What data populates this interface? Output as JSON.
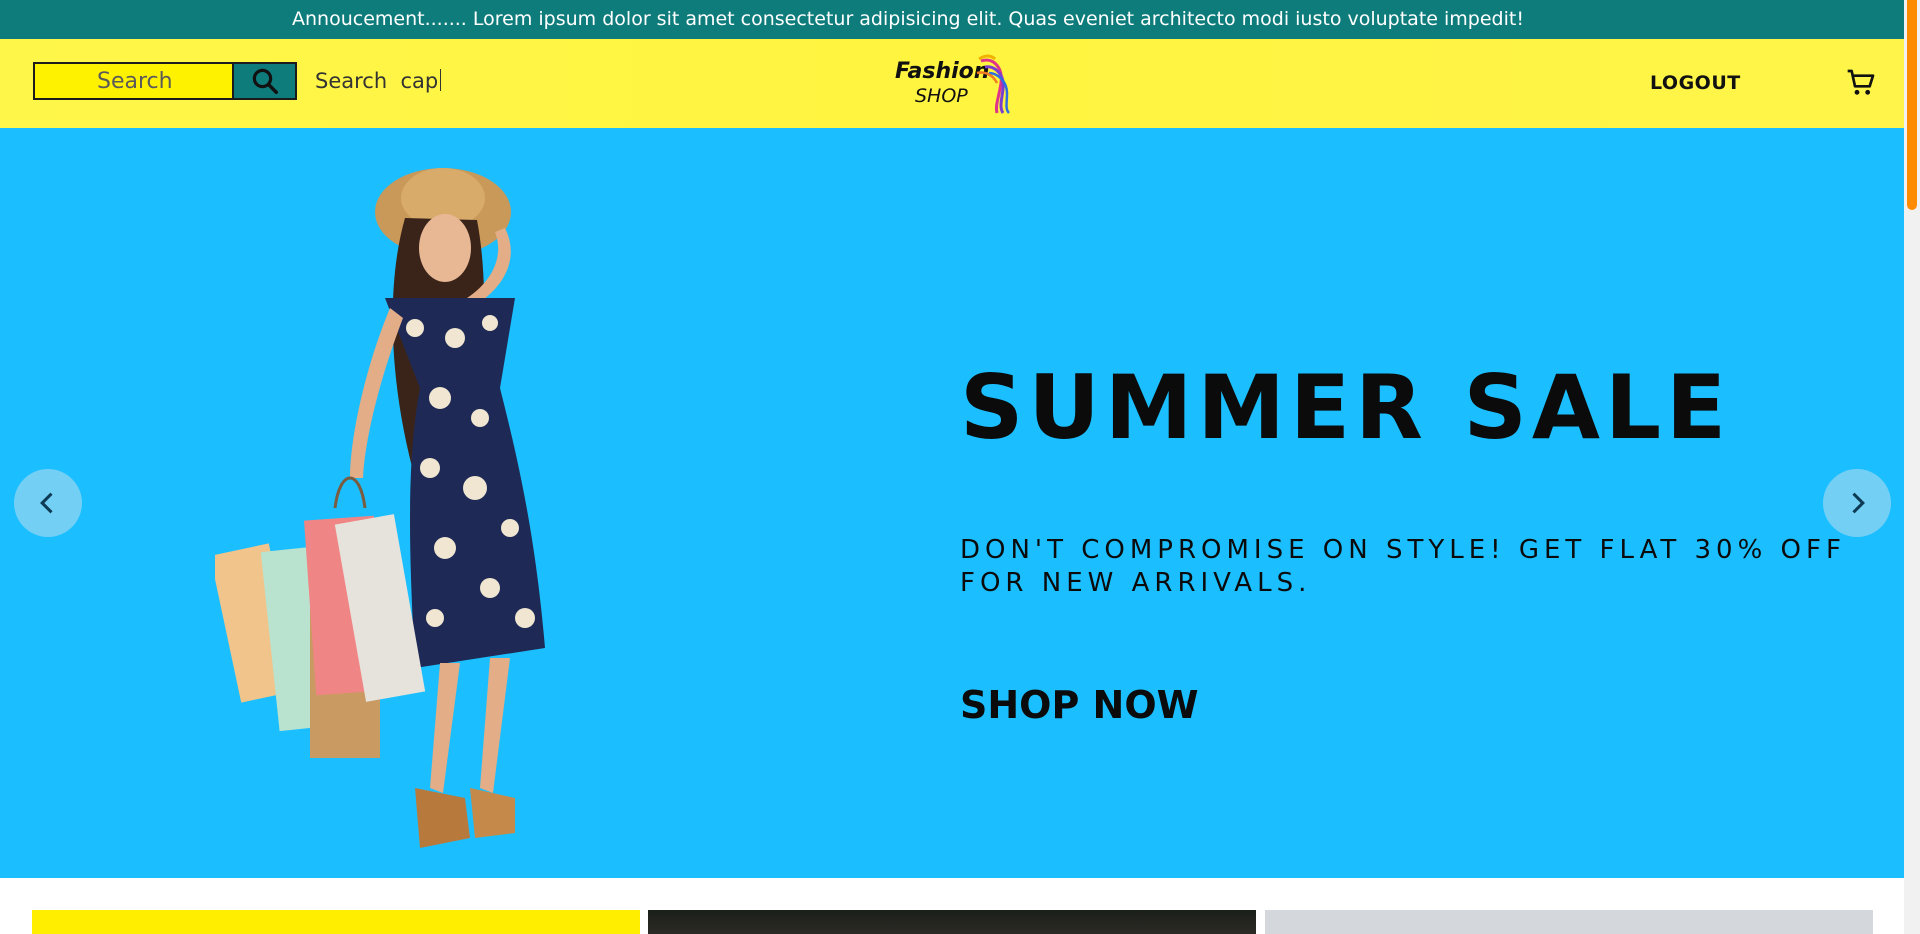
{
  "announcement": {
    "text": "Annoucement....... Lorem ipsum dolor sit amet consectetur adipisicing elit. Quas eveniet architecto modi iusto voluptate impedit!"
  },
  "navbar": {
    "search_placeholder": "Search",
    "search_label": "Search  cap",
    "logo_top": "Fashion",
    "logo_bottom": "SHOP",
    "logout_label": "LOGOUT",
    "cart_icon": "cart-icon",
    "search_icon": "search-icon"
  },
  "hero": {
    "title": "SUMMER SALE",
    "subtitle": "DON'T COMPROMISE ON STYLE! GET FLAT 30% OFF FOR NEW ARRIVALS.",
    "cta": "SHOP NOW",
    "prev_icon": "chevron-left-icon",
    "next_icon": "chevron-right-icon"
  },
  "colors": {
    "announcement_bg": "#0f7c7c",
    "navbar_bg": "#fff43f",
    "hero_bg": "#1bbfff",
    "scroll_thumb": "#ff8c00"
  }
}
